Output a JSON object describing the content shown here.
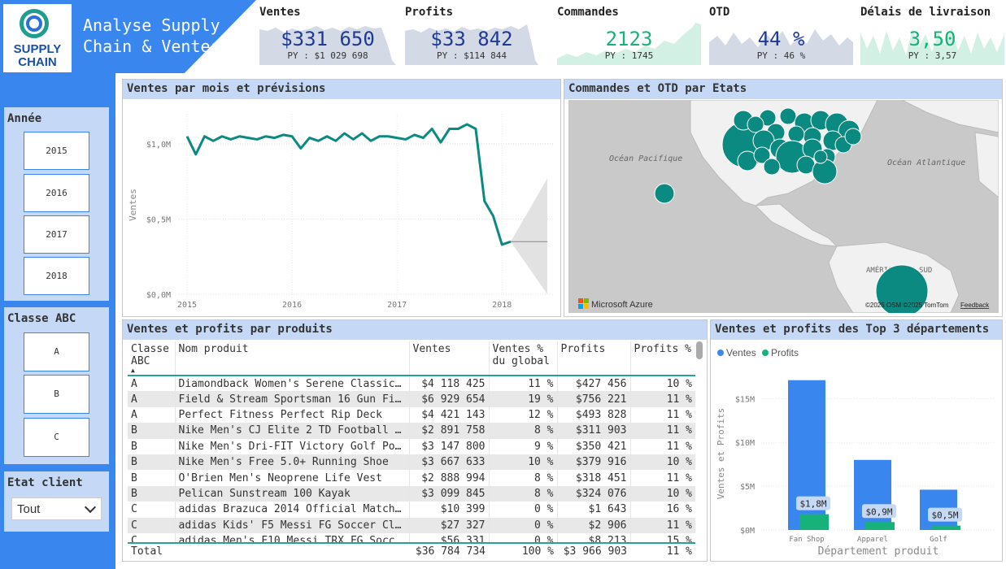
{
  "header": {
    "title": "Analyse Supply\nChain & Ventes",
    "logo_text_1": "SUPPLY",
    "logo_text_2": "CHAIN"
  },
  "kpis": [
    {
      "label": "Ventes",
      "value": "$331 650",
      "py": "PY : $1 029 698",
      "color": "#1f3a93"
    },
    {
      "label": "Profits",
      "value": "$33 842",
      "py": "PY : $114 844",
      "color": "#1f3a93"
    },
    {
      "label": "Commandes",
      "value": "2123",
      "py": "PY : 1745",
      "color": "#17b27a"
    },
    {
      "label": "OTD",
      "value": "44 %",
      "py": "PY : 46 %",
      "color": "#1f3a93"
    },
    {
      "label": "Délais de livraison",
      "value": "3,50",
      "py": "PY : 3,57",
      "color": "#17b27a"
    }
  ],
  "filters": {
    "year": {
      "title": "Année",
      "options": [
        "2015",
        "2016",
        "2017",
        "2018"
      ]
    },
    "abc": {
      "title": "Classe ABC",
      "options": [
        "A",
        "B",
        "C"
      ]
    },
    "state": {
      "title": "Etat client",
      "selected": "Tout"
    }
  },
  "line_panel": {
    "title": "Ventes par mois et prévisions"
  },
  "map_panel": {
    "title": "Commandes et OTD par Etats",
    "labels": {
      "pacific": "Océan Pacifique",
      "atlantic": "Océan Atlantique",
      "south_america": "AMÉRIQUE DU SUD",
      "brand": "Microsoft Azure",
      "credit": "©2025 OSM ©2025 TomTom",
      "feedback": "Feedback"
    }
  },
  "table_panel": {
    "title": "Ventes et profits par produits",
    "headers": [
      "Classe ABC",
      "Nom produit",
      "Ventes",
      "Ventes % du global",
      "Profits",
      "Profits %"
    ],
    "rows": [
      [
        "A",
        "Diamondback Women's Serene Classic…",
        "$4 118 425",
        "11 %",
        "$427 456",
        "10 %"
      ],
      [
        "A",
        "Field & Stream Sportsman 16 Gun Fi…",
        "$6 929 654",
        "19 %",
        "$756 221",
        "11 %"
      ],
      [
        "A",
        "Perfect Fitness Perfect Rip Deck",
        "$4 421 143",
        "12 %",
        "$493 828",
        "11 %"
      ],
      [
        "B",
        "Nike Men's CJ Elite 2 TD Football …",
        "$2 891 758",
        "8 %",
        "$311 903",
        "11 %"
      ],
      [
        "B",
        "Nike Men's Dri-FIT Victory Golf Po…",
        "$3 147 800",
        "9 %",
        "$350 421",
        "11 %"
      ],
      [
        "B",
        "Nike Men's Free 5.0+ Running Shoe",
        "$3 667 633",
        "10 %",
        "$379 916",
        "10 %"
      ],
      [
        "B",
        "O'Brien Men's Neoprene Life Vest",
        "$2 888 994",
        "8 %",
        "$318 451",
        "11 %"
      ],
      [
        "B",
        "Pelican Sunstream 100 Kayak",
        "$3 099 845",
        "8 %",
        "$324 076",
        "10 %"
      ],
      [
        "C",
        "adidas Brazuca 2014 Official Match…",
        "$10 399",
        "0 %",
        "$1 643",
        "16 %"
      ],
      [
        "C",
        "adidas Kids' F5 Messi FG Soccer Cl…",
        "$27 327",
        "0 %",
        "$2 906",
        "11 %"
      ],
      [
        "C",
        "adidas Men's F10 Messi TRX FG Socc…",
        "$56 331",
        "0 %",
        "$8 213",
        "15 %"
      ]
    ],
    "total": [
      "Total",
      "",
      "$36 784 734",
      "100 %",
      "$3 966 903",
      "11 %"
    ]
  },
  "chart_data": [
    {
      "type": "line",
      "title": "Ventes par mois et prévisions",
      "ylabel": "Ventes",
      "ylim": [
        0,
        1.2
      ],
      "yticks": [
        "$0,0M",
        "$0,5M",
        "$1,0M"
      ],
      "xticks": [
        "2015",
        "2016",
        "2017",
        "2018"
      ],
      "x": [
        "2015-01",
        "2015-02",
        "2015-03",
        "2015-04",
        "2015-05",
        "2015-06",
        "2015-07",
        "2015-08",
        "2015-09",
        "2015-10",
        "2015-11",
        "2015-12",
        "2016-01",
        "2016-02",
        "2016-03",
        "2016-04",
        "2016-05",
        "2016-06",
        "2016-07",
        "2016-08",
        "2016-09",
        "2016-10",
        "2016-11",
        "2016-12",
        "2017-01",
        "2017-02",
        "2017-03",
        "2017-04",
        "2017-05",
        "2017-06",
        "2017-07",
        "2017-08",
        "2017-09",
        "2017-10",
        "2017-11",
        "2017-12",
        "2018-01",
        "2018-02"
      ],
      "series": [
        {
          "values": [
            1.05,
            0.93,
            1.05,
            1.02,
            1.05,
            1.03,
            1.05,
            1.04,
            1.03,
            1.05,
            1.04,
            1.06,
            1.05,
            0.97,
            1.04,
            1.02,
            1.05,
            1.02,
            1.07,
            1.03,
            1.07,
            1.02,
            1.05,
            1.05,
            1.04,
            1.03,
            1.06,
            1.04,
            1.1,
            1.01,
            1.1,
            1.1,
            1.13,
            1.1,
            0.62,
            0.52,
            0.33,
            0.35
          ]
        }
      ],
      "forecast": {
        "x_start": "2018-02",
        "x_end": "2018-06",
        "value": 0.35,
        "upper": 0.77,
        "lower": 0.0
      }
    },
    {
      "type": "bar",
      "title": "Ventes et profits des Top 3 départements",
      "xlabel": "Département produit",
      "ylabel": "Ventes et Profits",
      "ylim": [
        0,
        18
      ],
      "yticks": [
        "$0M",
        "$5M",
        "$10M",
        "$15M"
      ],
      "categories": [
        "Fan Shop",
        "Apparel",
        "Golf"
      ],
      "series": [
        {
          "name": "Ventes",
          "values": [
            17.1,
            8.0,
            4.6
          ],
          "color": "#3a86ef"
        },
        {
          "name": "Profits",
          "values": [
            1.8,
            0.9,
            0.5
          ],
          "color": "#17b27a"
        }
      ],
      "data_labels": [
        "$1,8M",
        "$0,9M",
        "$0,5M"
      ],
      "legend": "top-left"
    }
  ]
}
